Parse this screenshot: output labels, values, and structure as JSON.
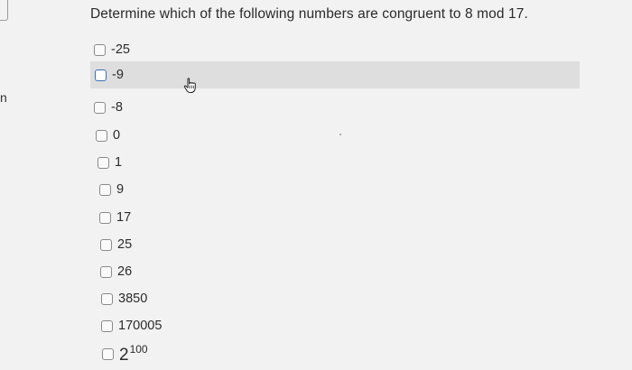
{
  "page": {
    "edge_text": "n",
    "question": "Determine which of the following numbers are congruent to 8 mod 17."
  },
  "options": [
    {
      "label": "-25"
    },
    {
      "label": "-9"
    },
    {
      "label": "-8"
    },
    {
      "label": "0"
    },
    {
      "label": "1"
    },
    {
      "label": "9"
    },
    {
      "label": "17"
    },
    {
      "label": "25"
    },
    {
      "label": "26"
    },
    {
      "label": "3850"
    },
    {
      "label": "170005"
    },
    {
      "label_base": "2",
      "label_exp": "100"
    }
  ],
  "highlighted_option": "-9",
  "icons": {
    "cursor": "hand-pointer-icon"
  }
}
